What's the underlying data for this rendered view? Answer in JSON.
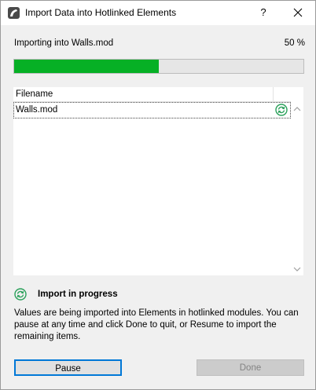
{
  "window": {
    "title": "Import Data into Hotlinked Elements",
    "help_label": "?",
    "app_icon": "archicad-app-icon",
    "close_icon": "close-icon"
  },
  "status": {
    "label": "Importing into Walls.mod",
    "percent_text": "50 %",
    "progress": 0.5,
    "progress_color": "#06b025"
  },
  "list": {
    "header": "Filename",
    "rows": [
      {
        "filename": "Walls.mod",
        "status_icon": "sync-progress-icon"
      }
    ]
  },
  "info": {
    "icon": "sync-progress-icon",
    "title": "Import in progress",
    "body": "Values are being imported into Elements in hotlinked modules. You can pause at any time and click Done to quit, or Resume to import the remaining items."
  },
  "buttons": {
    "pause_label": "Pause",
    "done_label": "Done"
  }
}
